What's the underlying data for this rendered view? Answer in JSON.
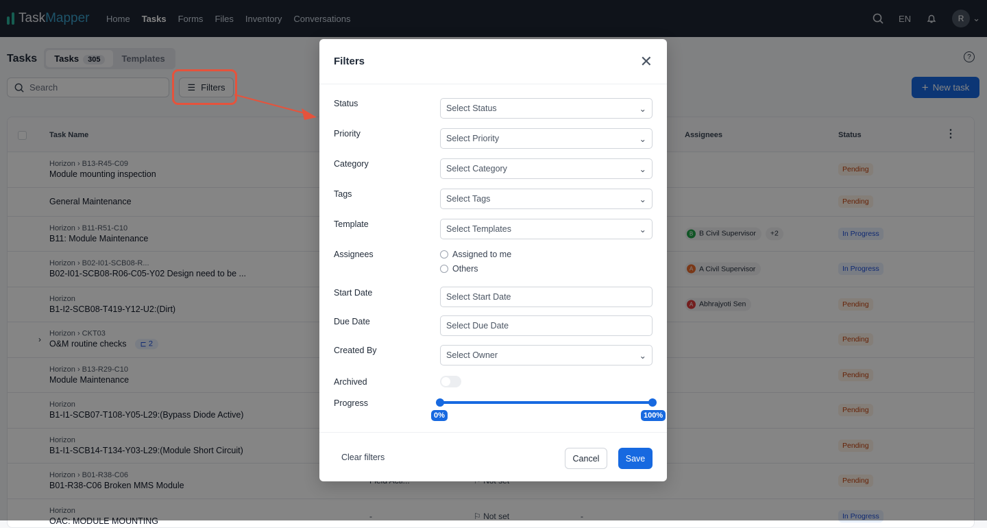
{
  "nav": {
    "logo_a": "Task",
    "logo_b": "Mapper",
    "items": [
      "Home",
      "Tasks",
      "Forms",
      "Files",
      "Inventory",
      "Conversations"
    ],
    "active": "Tasks",
    "lang": "EN",
    "avatar": "R"
  },
  "page": {
    "title": "Tasks",
    "tab_tasks": "Tasks",
    "tab_count": "305",
    "tab_templates": "Templates",
    "search_placeholder": "Search",
    "filters_label": "Filters",
    "new_task": "New task",
    "help": "?"
  },
  "table": {
    "columns": {
      "name": "Task Name",
      "assignees": "Assignees",
      "status": "Status"
    },
    "rows": [
      {
        "crumb": "Horizon › B13-R45-C09",
        "name": "Module mounting inspection",
        "status": "Pending"
      },
      {
        "crumb": "",
        "name": "General Maintenance",
        "status": "Pending"
      },
      {
        "crumb": "Horizon › B11-R51-C10",
        "name": "B11: Module Maintenance",
        "status": "In Progress",
        "assignee": "B Civil Supervisor",
        "initial": "B",
        "color": "#22a34a",
        "extra": "+2"
      },
      {
        "crumb": "Horizon › B02-I01-SCB08-R...",
        "name": "B02-I01-SCB08-R06-C05-Y02 Design need to be ...",
        "status": "In Progress",
        "assignee": "A Civil Supervisor",
        "initial": "A",
        "color": "#ea6b2d"
      },
      {
        "crumb": "Horizon",
        "name": "B1-I2-SCB08-T419-Y12-U2:(Dirt)",
        "status": "Pending",
        "assignee": "Abhrajyoti Sen",
        "initial": "A",
        "color": "#dc3b3b"
      },
      {
        "crumb": "Horizon › CKT03",
        "name": "O&M routine checks",
        "status": "Pending",
        "subtasks": "2",
        "expandable": true
      },
      {
        "crumb": "Horizon › B13-R29-C10",
        "name": "Module Maintenance",
        "status": "Pending"
      },
      {
        "crumb": "Horizon",
        "name": "B1-I1-SCB07-T108-Y05-L29:(Bypass Diode Active)",
        "status": "Pending"
      },
      {
        "crumb": "Horizon",
        "name": "B1-I1-SCB14-T134-Y03-L29:(Module Short Circuit)",
        "status": "Pending"
      },
      {
        "crumb": "Horizon › B01-R38-C06",
        "name": "B01-R38-C06 Broken MMS Module",
        "status": "Pending",
        "category": "Field Acti...",
        "priority": "Not set"
      },
      {
        "crumb": "Horizon",
        "name": "OAC: MODULE MOUNTING",
        "status": "In Progress",
        "category": "-",
        "priority": "Not set",
        "extra_cell": "-"
      }
    ]
  },
  "modal": {
    "title": "Filters",
    "selects": [
      {
        "label": "Status",
        "placeholder": "Select Status"
      },
      {
        "label": "Priority",
        "placeholder": "Select Priority"
      },
      {
        "label": "Category",
        "placeholder": "Select Category"
      },
      {
        "label": "Tags",
        "placeholder": "Select Tags"
      },
      {
        "label": "Template",
        "placeholder": "Select Templates"
      }
    ],
    "assignees_label": "Assignees",
    "assigned_to_me": "Assigned to me",
    "others": "Others",
    "start_label": "Start Date",
    "start_placeholder": "Select Start Date",
    "due_label": "Due Date",
    "due_placeholder": "Select Due Date",
    "created_label": "Created By",
    "created_placeholder": "Select Owner",
    "archived_label": "Archived",
    "archived_on": false,
    "progress_label": "Progress",
    "progress_min": "0%",
    "progress_max": "100%",
    "progress_range": [
      0,
      100
    ],
    "clear": "Clear filters",
    "cancel": "Cancel",
    "save": "Save"
  },
  "colors": {
    "accent": "#1769e0",
    "annotation": "#e5533c"
  }
}
